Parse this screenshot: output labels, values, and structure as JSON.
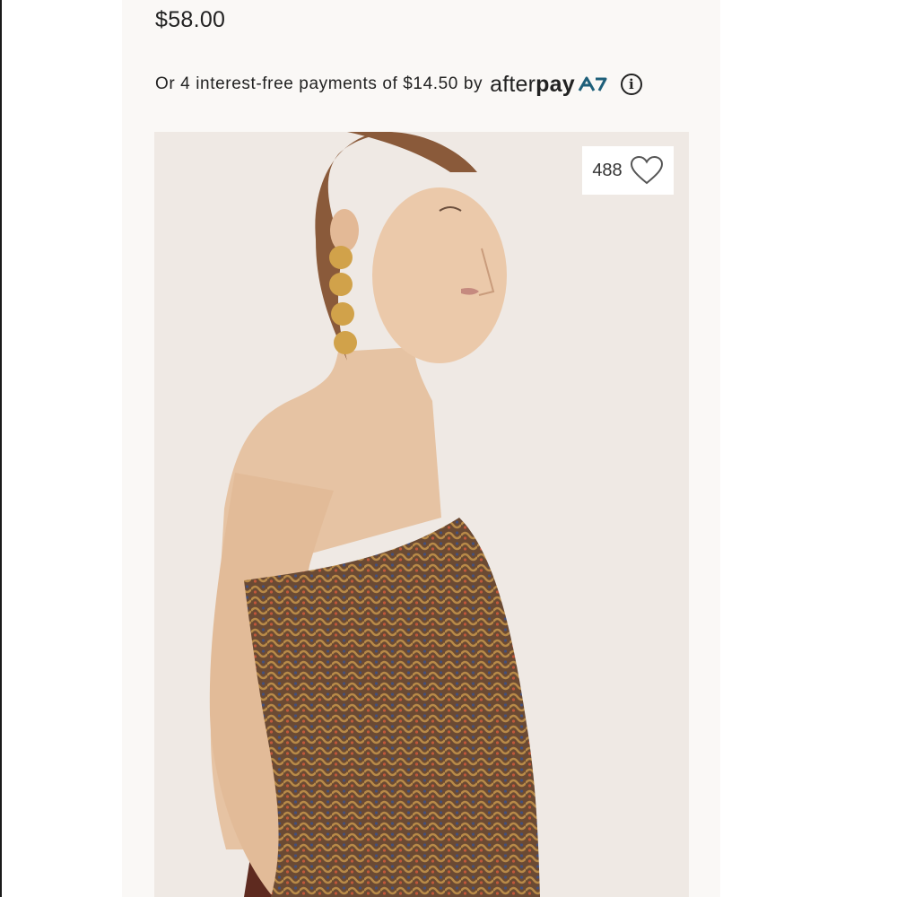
{
  "product": {
    "price": "$58.00",
    "installment_text": "Or 4 interest-free payments of $14.50 by",
    "afterpay": {
      "after": "after",
      "pay": "pay",
      "accent": "#1e5f7a"
    },
    "info_icon": "info-icon",
    "favorite_count": "488",
    "favorite_icon": "heart-outline-icon"
  },
  "colors": {
    "panel": "#faf8f6",
    "image_bg": "#efe9e4",
    "text": "#222222"
  }
}
